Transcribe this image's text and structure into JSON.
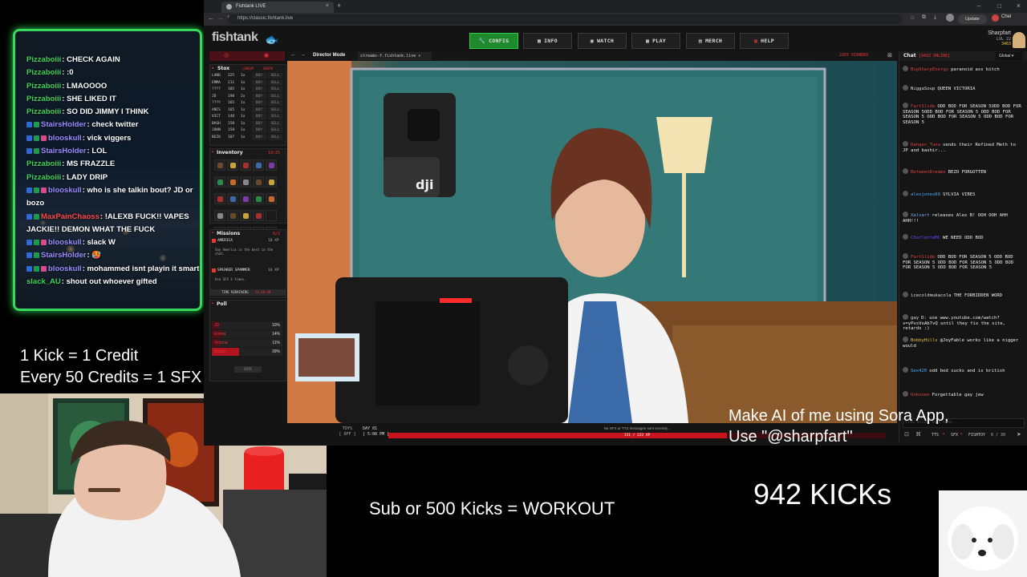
{
  "overlay": {
    "chat_lines": [
      {
        "user": "Pizzaboiii",
        "text": "CHECK AGAIN",
        "color": "#3fd25a",
        "badges": 0
      },
      {
        "user": "Pizzaboiii",
        "text": ":0",
        "color": "#3fd25a",
        "badges": 0
      },
      {
        "user": "Pizzaboiii",
        "text": "LMAOOOO",
        "color": "#3fd25a",
        "badges": 0
      },
      {
        "user": "Pizzaboiii",
        "text": "SHE LIKED IT",
        "color": "#3fd25a",
        "badges": 0
      },
      {
        "user": "Pizzaboiii",
        "text": "SO DID JIMMY I THINK",
        "color": "#3fd25a",
        "badges": 0
      },
      {
        "user": "StairsHolder",
        "text": "check twitter",
        "color": "#9a8dff",
        "badges": 2
      },
      {
        "user": "blooskull",
        "text": "vick viggers",
        "color": "#9a8dff",
        "badges": 3
      },
      {
        "user": "StairsHolder",
        "text": "LOL",
        "color": "#9a8dff",
        "badges": 2
      },
      {
        "user": "Pizzaboiii",
        "text": "MS FRAZZLE",
        "color": "#3fd25a",
        "badges": 0
      },
      {
        "user": "Pizzaboiii",
        "text": "LADY DRIP",
        "color": "#3fd25a",
        "badges": 0
      },
      {
        "user": "blooskull",
        "text": "who is she talkin bout? JD or bozo",
        "color": "#9a8dff",
        "badges": 3
      },
      {
        "user": "MaxPainChaoss",
        "text": "!ALEXB FUCK!! VAPES JACKIE!! DEMON WHAT THE FUCK",
        "color": "#ff4a4a",
        "badges": 2
      },
      {
        "user": "blooskull",
        "text": "slack W",
        "color": "#9a8dff",
        "badges": 3
      },
      {
        "user": "StairsHolder",
        "text": "🥵",
        "color": "#9a8dff",
        "badges": 2
      },
      {
        "user": "blooskull",
        "text": "mohammed isnt playin it smart",
        "color": "#9a8dff",
        "badges": 3
      },
      {
        "user": "slack_AU",
        "text": "shout out whoever gifted",
        "color": "#3fd25a",
        "badges": 0
      }
    ],
    "kick_credit": "1 Kick = 1 Credit",
    "credits_sfx": "Every 50 Credits  = 1 SFX",
    "sora_line1": "Make AI of me using Sora App,",
    "sora_line2": "Use \"@sharpfart\"",
    "kicks_count": "942 KICKs",
    "workout": "Sub or 500 Kicks = WORKOUT"
  },
  "browser": {
    "tab_title": "Fishtank LIVE",
    "url": "https://classic.fishtank.live",
    "update_label": "Update",
    "profile_label": "Chel"
  },
  "site": {
    "logo": "fishtank",
    "nav": [
      "CONFIG",
      "INFO",
      "WATCH",
      "PLAY",
      "MERCH",
      "HELP"
    ],
    "user": {
      "name": "Sharpfart",
      "level": "LVL 22",
      "coins": "3463"
    },
    "stox": {
      "title": "Stox",
      "tabs": [
        "LOOKUP",
        "GRAPH"
      ],
      "rows": [
        {
          "sym": "LAND",
          "val": "325",
          "q": "1x"
        },
        {
          "sym": "EMMA",
          "val": "211",
          "q": "1x"
        },
        {
          "sym": "????",
          "val": "185",
          "q": "1x"
        },
        {
          "sym": "JD",
          "val": "198",
          "q": "2x"
        },
        {
          "sym": "???Y",
          "val": "165",
          "q": "1x"
        },
        {
          "sym": "ANIS",
          "val": "165",
          "q": "1x"
        },
        {
          "sym": "VICT",
          "val": "148",
          "q": "1x"
        },
        {
          "sym": "BASH",
          "val": "158",
          "q": "1x"
        },
        {
          "sym": "JOHN",
          "val": "158",
          "q": "1x"
        },
        {
          "sym": "BEZO",
          "val": "107",
          "q": "1x"
        }
      ],
      "buy": "BUY",
      "sell": "SELL"
    },
    "inventory": {
      "title": "Inventory",
      "count": "19/25"
    },
    "missions": {
      "title": "Missions",
      "count": "0/2",
      "items": [
        {
          "name": "AMERICA",
          "xp": "10 XP",
          "desc": "Say America is the best in the chat."
        },
        {
          "name": "SPEAKER SPAMMER",
          "xp": "10 XP",
          "desc": "Use SFX 3 times."
        }
      ],
      "time_label": "TIME REMAINING",
      "time_value": "21:48:48"
    },
    "poll": {
      "title": "Poll",
      "options": [
        {
          "name": "JD",
          "pct": "10%",
          "value": 10
        },
        {
          "name": "Emma",
          "pct": "14%",
          "value": 14
        },
        {
          "name": "Victoria",
          "pct": "11%",
          "value": 11
        },
        {
          "name": "Bashir",
          "pct": "39%",
          "value": 39
        }
      ],
      "vote": "VOTE"
    },
    "stream": {
      "mode": "Director Mode",
      "stream_name": "streams-f.fishtank.live",
      "viewers": "2207 VIEWERS",
      "toys": "TOYS",
      "toys_state": "OFF",
      "day": "DAY 01",
      "time": "5:08 PM",
      "status": "No SFX or TTS messages sent recently...",
      "xp": "151 / 222 XP",
      "xp_frac": 0.68
    },
    "chat": {
      "title": "Chat",
      "online": "9493 ONLINE",
      "room": "Global",
      "messages": [
        {
          "user": "BigSharpEnergy",
          "text": "paranoid ass bitch",
          "color": "#d94040"
        },
        {
          "user": "NiggaSoup",
          "text": "QUEEN VICTORIA",
          "color": "#dddddd"
        },
        {
          "user": "FartSlide",
          "text": "ODD BOD FOR SEASON 5ODD BOD FOR SEASON 5ODD BOD FOR SEASON 5 ODD BOD FOR SEASON 5 ODD BOD FOR SEASON 5 ODD BOD FOR SEASON 5",
          "color": "#d94040"
        },
        {
          "user": "Danger_Tuna",
          "text": "sends their Refined Meth to JP and bashir...",
          "color": "#d94040"
        },
        {
          "user": "BetweenDreams",
          "text": "BEZO FORGOTTEN",
          "color": "#d94040"
        },
        {
          "user": "alexjones69",
          "text": "SYLVIA VIBES",
          "color": "#4aa8ff"
        },
        {
          "user": "Xalvart",
          "text": "releases Alex B! OOH OOH AHH AHH!!!",
          "color": "#7aa8ff"
        },
        {
          "user": "CharlotteMC",
          "text": "WE NEED ODD BOD",
          "color": "#5555ff"
        },
        {
          "user": "FartSlide",
          "text": "ODD BOD FOR SEASON 5 ODD BOD FOR SEASON 5 ODD BOD FOR SEASON 5 ODD BOD FOR SEASON 5 ODD BOD FOR SEASON 5",
          "color": "#d94040"
        },
        {
          "user": "icecoldmukacola",
          "text": "THE FORBIDDEN WORD",
          "color": "#dddddd"
        },
        {
          "user": "gay",
          "text": "D: use www.youtube.com/watch?v=yPvsVoAb7vQ until they fix the site, retards :)",
          "color": "#dddddd"
        },
        {
          "user": "BobbyHills",
          "text": "@JoyFable works like a nigger would",
          "color": "#e0c040"
        },
        {
          "user": "Sex420",
          "text": "odd bod sucks and is british",
          "color": "#4aa8ff"
        },
        {
          "user": "Unknown",
          "text": "Forgettable gay jew",
          "color": "#d94040"
        }
      ],
      "input_placeholder": "Free online chat here...",
      "footer": [
        "TTS",
        "SFX",
        "FISHTOY"
      ],
      "fishtoy_count": "0 / 30"
    }
  }
}
